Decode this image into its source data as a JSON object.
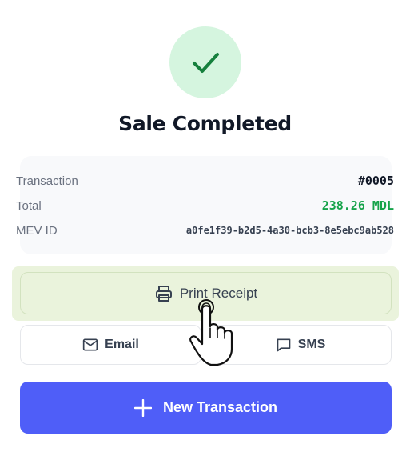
{
  "header": {
    "icon": "check-icon",
    "title": "Sale Completed"
  },
  "details": {
    "transaction_label": "Transaction",
    "transaction_value": "#0005",
    "total_label": "Total",
    "total_value": "238.26 MDL",
    "mev_label": "MEV ID",
    "mev_value": "a0fe1f39-b2d5-4a30-bcb3-8e5ebc9ab528"
  },
  "actions": {
    "print_label": "Print Receipt",
    "print_icon": "printer-icon",
    "email_label": "Email",
    "email_icon": "mail-icon",
    "sms_label": "SMS",
    "sms_icon": "message-icon",
    "new_label": "New Transaction",
    "new_icon": "plus-icon"
  },
  "colors": {
    "accent": "#4f5ef8",
    "success": "#16a34a",
    "success_bg": "#d5f5df",
    "highlight": "#eaf3dc"
  }
}
